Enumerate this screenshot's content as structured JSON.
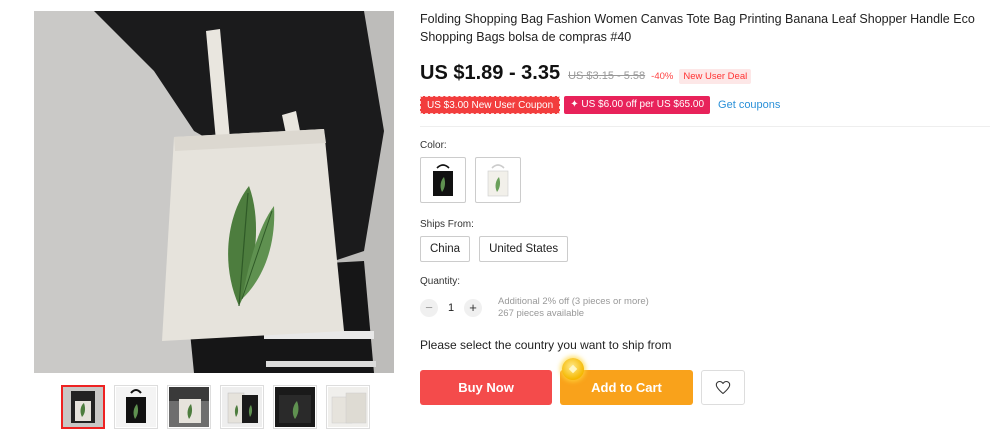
{
  "product": {
    "title": "Folding Shopping Bag Fashion Women Canvas Tote Bag Printing Banana Leaf Shopper Handle Eco Shopping Bags bolsa de compras #40"
  },
  "pricing": {
    "price_range": "US $1.89 - 3.35",
    "original_range": "US $3.15 - 5.58",
    "discount": "-40%",
    "deal_badge": "New User Deal"
  },
  "coupons": {
    "new_user": "US $3.00 New User Coupon",
    "store": "✦ US $6.00 off per US $65.00",
    "link": "Get coupons"
  },
  "options": {
    "color_label": "Color:",
    "colors": [
      "black-tote-leaf",
      "white-tote-leaf"
    ],
    "ships_from_label": "Ships From:",
    "ships_from": [
      "China",
      "United States"
    ],
    "quantity_label": "Quantity:",
    "quantity": "1",
    "qty_minus": "−",
    "qty_plus": "+",
    "qty_note_line1": "Additional 2% off (3 pieces or more)",
    "qty_note_line2": "267 pieces available"
  },
  "shipping_prompt": "Please select the country you want to ship from",
  "actions": {
    "buy_now": "Buy Now",
    "add_to_cart": "Add to Cart",
    "wishlist_icon": "heart-icon"
  },
  "gallery": {
    "thumbnail_count": 6,
    "active_index": 0
  },
  "colors": {
    "buy_now": "#f44b4b",
    "add_to_cart": "#f9a21b",
    "price_red": "#f44444",
    "link_blue": "#2a90d8",
    "active_thumb": "#e22222"
  }
}
